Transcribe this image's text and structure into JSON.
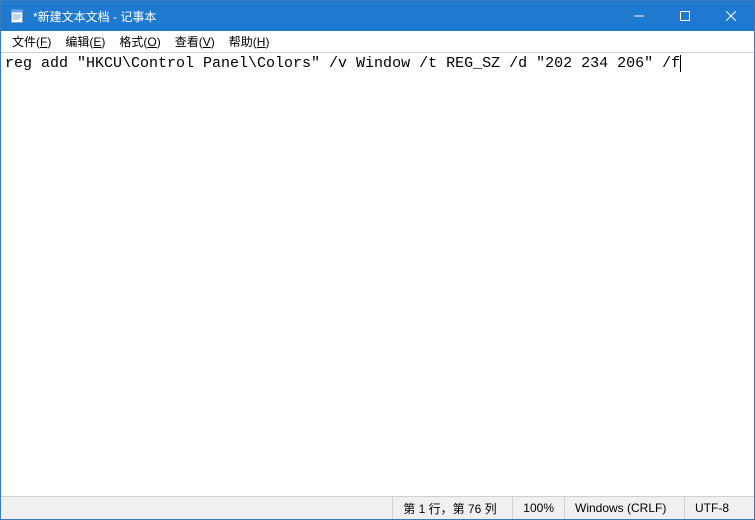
{
  "titlebar": {
    "title": "*新建文本文档 - 记事本"
  },
  "menu": {
    "file": {
      "label": "文件",
      "accel": "F"
    },
    "edit": {
      "label": "编辑",
      "accel": "E"
    },
    "format": {
      "label": "格式",
      "accel": "O"
    },
    "view": {
      "label": "查看",
      "accel": "V"
    },
    "help": {
      "label": "帮助",
      "accel": "H"
    }
  },
  "editor": {
    "content": "reg add \"HKCU\\Control Panel\\Colors\" /v Window /t REG_SZ /d \"202 234 206\" /f"
  },
  "statusbar": {
    "position": "第 1 行，第 76 列",
    "zoom": "100%",
    "eol": "Windows (CRLF)",
    "encoding": "UTF-8"
  }
}
